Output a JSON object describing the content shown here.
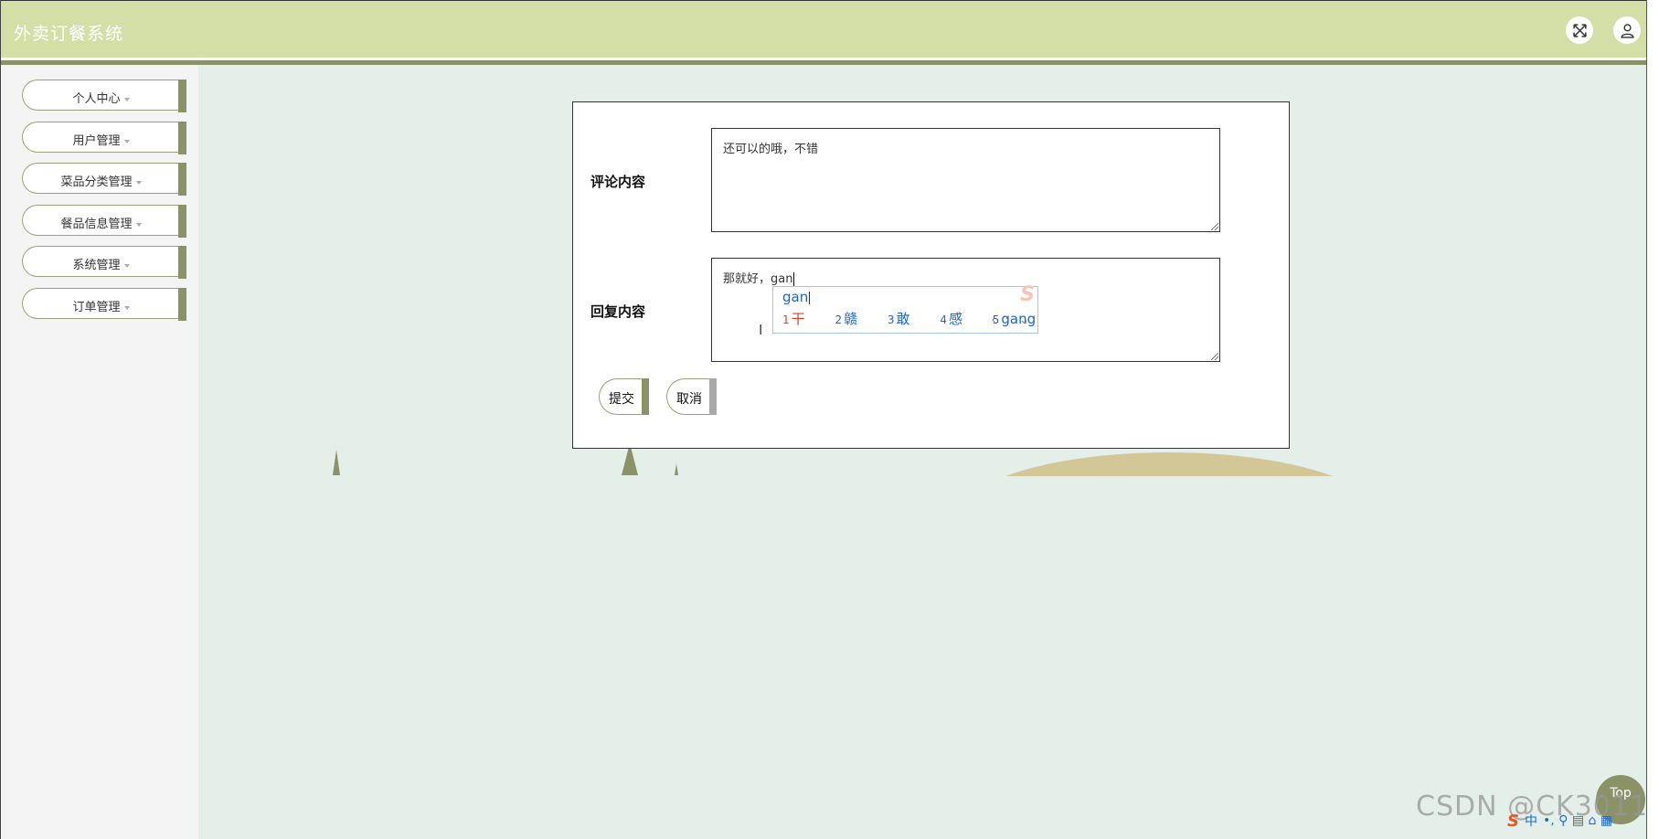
{
  "app": {
    "title": "外卖订餐系统"
  },
  "header": {
    "fullscreen_icon": "expand-icon",
    "user_icon": "user-icon"
  },
  "sidebar": {
    "items": [
      {
        "label": "个人中心"
      },
      {
        "label": "用户管理"
      },
      {
        "label": "菜品分类管理"
      },
      {
        "label": "餐品信息管理"
      },
      {
        "label": "系统管理"
      },
      {
        "label": "订单管理"
      }
    ]
  },
  "form": {
    "comment_label": "评论内容",
    "comment_value": "还可以的哦，不错",
    "reply_label": "回复内容",
    "reply_value": "那就好，gan",
    "submit_label": "提交",
    "cancel_label": "取消"
  },
  "ime_popup": {
    "composition": "gan",
    "candidates": [
      {
        "num": "1",
        "text": "干"
      },
      {
        "num": "2",
        "text": "赣"
      },
      {
        "num": "3",
        "text": "敢"
      },
      {
        "num": "4",
        "text": "感"
      },
      {
        "num": "5",
        "text": "gang"
      }
    ],
    "nav": "‹ › ⌄"
  },
  "top_button": {
    "label": "Top"
  },
  "watermark": "CSDN @CK3011",
  "ime_tray": {
    "logo": "S",
    "mode": "中",
    "icons": "•, ⚲ ▤ ⌂ ▦"
  },
  "colors": {
    "header_bg": "#d3dfa7",
    "accent": "#8b9268",
    "main_bg": "#e4efe9",
    "sidebar_bg": "#f4f4f4"
  }
}
